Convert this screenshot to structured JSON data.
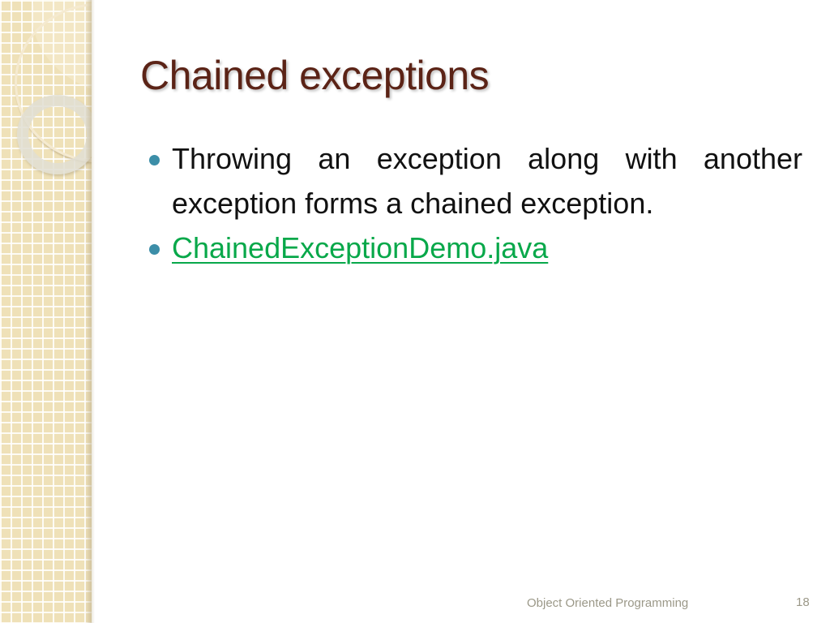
{
  "slide": {
    "title": "Chained exceptions",
    "bullets": [
      {
        "text": "Throwing an exception along with another exception forms a chained exception.",
        "is_link": false
      },
      {
        "text": "ChainedExceptionDemo.java",
        "is_link": true
      }
    ],
    "footer": "Object Oriented Programming",
    "page_number": "18"
  },
  "colors": {
    "title": "#5b2316",
    "bullet": "#3c8ea8",
    "link": "#08a84a",
    "footer": "#9b9888",
    "sidebar": "#efe1b8"
  }
}
